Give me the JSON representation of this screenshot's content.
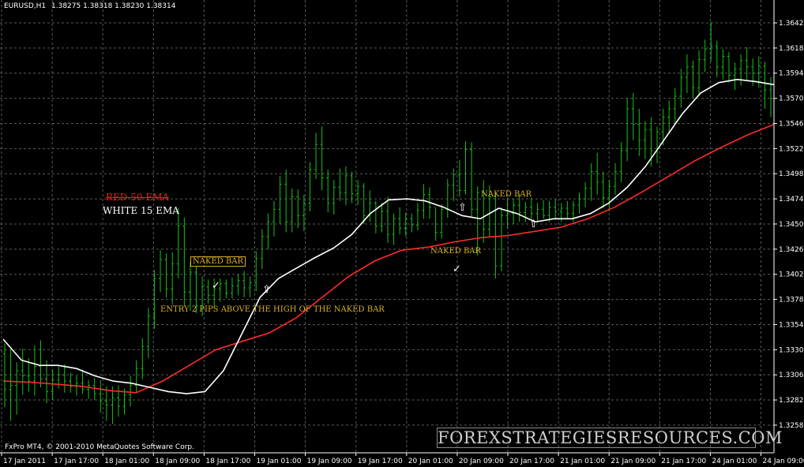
{
  "header": {
    "symbol": "EURUSD,H1",
    "quote": "1.38275 1.38318 1.38230 1.38314"
  },
  "footer": {
    "copyright": "FxPro MT4, © 2001-2010 MetaQuotes Software Corp.",
    "watermark": "FOREXSTRATEGIESRESOURCES.COM"
  },
  "legend": {
    "red_label": "RED 50 EMA",
    "white_label": "WHITE 15 EMA"
  },
  "annotations": {
    "naked_bar_1": "NAKED BAR",
    "naked_bar_2": "NAKED BAR",
    "naked_bar_3": "NAKED BAR",
    "entry_note": "ENTRY 2 PIPS ABOVE THE HIGH OF THE NAKED BAR"
  },
  "markers": {
    "check_icon": "check-icon",
    "arrow_icon": "up-arrow-icon"
  },
  "colors": {
    "background": "#000000",
    "grid": "#5a5a5a",
    "bars": "#16c216",
    "ema15": "#ffffff",
    "ema50": "#ff2a2a",
    "annotation": "#d8b020",
    "axis_text": "#ffffff"
  },
  "chart_data": {
    "type": "ohlc",
    "title": "EURUSD,H1",
    "y_ticks": [
      "1.36420",
      "1.36180",
      "1.35940",
      "1.35700",
      "1.35460",
      "1.35220",
      "1.34980",
      "1.34740",
      "1.34500",
      "1.34260",
      "1.34020",
      "1.33780",
      "1.33540",
      "1.33300",
      "1.33060",
      "1.32820",
      "1.32580"
    ],
    "ylim": [
      1.3248,
      1.3652
    ],
    "x_ticks": [
      "17 Jan 2011",
      "17 Jan 17:00",
      "18 Jan 01:00",
      "18 Jan 09:00",
      "18 Jan 17:00",
      "19 Jan 01:00",
      "19 Jan 09:00",
      "19 Jan 17:00",
      "20 Jan 01:00",
      "20 Jan 09:00",
      "20 Jan 17:00",
      "21 Jan 01:00",
      "21 Jan 09:00",
      "21 Jan 17:00",
      "24 Jan 01:00",
      "24 Jan 09:00"
    ],
    "grid": true,
    "bars": [
      {
        "o": 1.3326,
        "h": 1.3336,
        "l": 1.3275,
        "c": 1.3292
      },
      {
        "o": 1.3292,
        "h": 1.333,
        "l": 1.3262,
        "c": 1.3296
      },
      {
        "o": 1.3296,
        "h": 1.3318,
        "l": 1.3268,
        "c": 1.331
      },
      {
        "o": 1.331,
        "h": 1.3331,
        "l": 1.3287,
        "c": 1.3305
      },
      {
        "o": 1.3305,
        "h": 1.3322,
        "l": 1.329,
        "c": 1.33
      },
      {
        "o": 1.33,
        "h": 1.3334,
        "l": 1.3286,
        "c": 1.3314
      },
      {
        "o": 1.3314,
        "h": 1.3339,
        "l": 1.3294,
        "c": 1.3302
      },
      {
        "o": 1.3302,
        "h": 1.332,
        "l": 1.3279,
        "c": 1.329
      },
      {
        "o": 1.329,
        "h": 1.3311,
        "l": 1.3282,
        "c": 1.3301
      },
      {
        "o": 1.3301,
        "h": 1.3314,
        "l": 1.3293,
        "c": 1.3306
      },
      {
        "o": 1.3306,
        "h": 1.3316,
        "l": 1.3289,
        "c": 1.33
      },
      {
        "o": 1.33,
        "h": 1.3308,
        "l": 1.3289,
        "c": 1.3295
      },
      {
        "o": 1.3295,
        "h": 1.3305,
        "l": 1.3286,
        "c": 1.3298
      },
      {
        "o": 1.3298,
        "h": 1.3311,
        "l": 1.3288,
        "c": 1.3292
      },
      {
        "o": 1.3292,
        "h": 1.3301,
        "l": 1.3283,
        "c": 1.3296
      },
      {
        "o": 1.3296,
        "h": 1.3303,
        "l": 1.3282,
        "c": 1.3288
      },
      {
        "o": 1.3288,
        "h": 1.3301,
        "l": 1.327,
        "c": 1.3281
      },
      {
        "o": 1.3281,
        "h": 1.3295,
        "l": 1.3262,
        "c": 1.3277
      },
      {
        "o": 1.3277,
        "h": 1.3295,
        "l": 1.3259,
        "c": 1.3284
      },
      {
        "o": 1.3284,
        "h": 1.3296,
        "l": 1.3266,
        "c": 1.3276
      },
      {
        "o": 1.3276,
        "h": 1.3293,
        "l": 1.3268,
        "c": 1.3287
      },
      {
        "o": 1.3287,
        "h": 1.3305,
        "l": 1.3276,
        "c": 1.3296
      },
      {
        "o": 1.3296,
        "h": 1.332,
        "l": 1.3289,
        "c": 1.3312
      },
      {
        "o": 1.3312,
        "h": 1.3341,
        "l": 1.3302,
        "c": 1.3333
      },
      {
        "o": 1.3333,
        "h": 1.337,
        "l": 1.3322,
        "c": 1.3362
      },
      {
        "o": 1.3362,
        "h": 1.3406,
        "l": 1.335,
        "c": 1.3398
      },
      {
        "o": 1.3398,
        "h": 1.3425,
        "l": 1.3385,
        "c": 1.3416
      },
      {
        "o": 1.3416,
        "h": 1.3422,
        "l": 1.338,
        "c": 1.3388
      },
      {
        "o": 1.3388,
        "h": 1.3423,
        "l": 1.3373,
        "c": 1.3412
      },
      {
        "o": 1.3412,
        "h": 1.3465,
        "l": 1.3398,
        "c": 1.3448
      },
      {
        "o": 1.3448,
        "h": 1.3456,
        "l": 1.3372,
        "c": 1.3385
      },
      {
        "o": 1.3385,
        "h": 1.3414,
        "l": 1.3367,
        "c": 1.3404
      },
      {
        "o": 1.3404,
        "h": 1.341,
        "l": 1.3365,
        "c": 1.3372
      },
      {
        "o": 1.3372,
        "h": 1.34,
        "l": 1.3362,
        "c": 1.339
      },
      {
        "o": 1.339,
        "h": 1.3397,
        "l": 1.3374,
        "c": 1.3382
      },
      {
        "o": 1.3382,
        "h": 1.3398,
        "l": 1.337,
        "c": 1.3388
      },
      {
        "o": 1.3388,
        "h": 1.3398,
        "l": 1.3376,
        "c": 1.3393
      },
      {
        "o": 1.3393,
        "h": 1.3397,
        "l": 1.3379,
        "c": 1.3384
      },
      {
        "o": 1.3384,
        "h": 1.3399,
        "l": 1.3379,
        "c": 1.3391
      },
      {
        "o": 1.3391,
        "h": 1.3402,
        "l": 1.3382,
        "c": 1.3396
      },
      {
        "o": 1.3396,
        "h": 1.3405,
        "l": 1.338,
        "c": 1.3389
      },
      {
        "o": 1.3389,
        "h": 1.34,
        "l": 1.338,
        "c": 1.3394
      },
      {
        "o": 1.3394,
        "h": 1.3424,
        "l": 1.3386,
        "c": 1.3417
      },
      {
        "o": 1.3417,
        "h": 1.3445,
        "l": 1.3407,
        "c": 1.3438
      },
      {
        "o": 1.3438,
        "h": 1.346,
        "l": 1.3426,
        "c": 1.3452
      },
      {
        "o": 1.3452,
        "h": 1.3472,
        "l": 1.3438,
        "c": 1.3464
      },
      {
        "o": 1.3464,
        "h": 1.3496,
        "l": 1.345,
        "c": 1.3488
      },
      {
        "o": 1.3488,
        "h": 1.3502,
        "l": 1.3442,
        "c": 1.3452
      },
      {
        "o": 1.3452,
        "h": 1.3484,
        "l": 1.3442,
        "c": 1.3476
      },
      {
        "o": 1.3476,
        "h": 1.3483,
        "l": 1.3446,
        "c": 1.3458
      },
      {
        "o": 1.3458,
        "h": 1.3478,
        "l": 1.3443,
        "c": 1.347
      },
      {
        "o": 1.347,
        "h": 1.3509,
        "l": 1.3462,
        "c": 1.3502
      },
      {
        "o": 1.3502,
        "h": 1.3537,
        "l": 1.3493,
        "c": 1.3526
      },
      {
        "o": 1.3526,
        "h": 1.3543,
        "l": 1.3482,
        "c": 1.3494
      },
      {
        "o": 1.3494,
        "h": 1.3502,
        "l": 1.3461,
        "c": 1.347
      },
      {
        "o": 1.347,
        "h": 1.3492,
        "l": 1.3459,
        "c": 1.3485
      },
      {
        "o": 1.3485,
        "h": 1.3503,
        "l": 1.3472,
        "c": 1.348
      },
      {
        "o": 1.348,
        "h": 1.3505,
        "l": 1.3468,
        "c": 1.3496
      },
      {
        "o": 1.3496,
        "h": 1.35,
        "l": 1.347,
        "c": 1.3479
      },
      {
        "o": 1.3479,
        "h": 1.3492,
        "l": 1.3468,
        "c": 1.3486
      },
      {
        "o": 1.3486,
        "h": 1.3489,
        "l": 1.345,
        "c": 1.3458
      },
      {
        "o": 1.3458,
        "h": 1.3482,
        "l": 1.3452,
        "c": 1.347
      },
      {
        "o": 1.347,
        "h": 1.3472,
        "l": 1.3441,
        "c": 1.3448
      },
      {
        "o": 1.3448,
        "h": 1.347,
        "l": 1.3442,
        "c": 1.3462
      },
      {
        "o": 1.3462,
        "h": 1.3476,
        "l": 1.3432,
        "c": 1.344
      },
      {
        "o": 1.344,
        "h": 1.346,
        "l": 1.343,
        "c": 1.3455
      },
      {
        "o": 1.3455,
        "h": 1.3466,
        "l": 1.344,
        "c": 1.3446
      },
      {
        "o": 1.3446,
        "h": 1.3461,
        "l": 1.3438,
        "c": 1.3455
      },
      {
        "o": 1.3455,
        "h": 1.346,
        "l": 1.3442,
        "c": 1.3449
      },
      {
        "o": 1.3449,
        "h": 1.347,
        "l": 1.3444,
        "c": 1.3463
      },
      {
        "o": 1.3463,
        "h": 1.3488,
        "l": 1.3455,
        "c": 1.3478
      },
      {
        "o": 1.3478,
        "h": 1.3485,
        "l": 1.3455,
        "c": 1.3466
      },
      {
        "o": 1.3466,
        "h": 1.3465,
        "l": 1.3434,
        "c": 1.3442
      },
      {
        "o": 1.3442,
        "h": 1.3469,
        "l": 1.3436,
        "c": 1.3464
      },
      {
        "o": 1.3464,
        "h": 1.3493,
        "l": 1.3456,
        "c": 1.3487
      },
      {
        "o": 1.3487,
        "h": 1.3503,
        "l": 1.3472,
        "c": 1.3497
      },
      {
        "o": 1.3497,
        "h": 1.3511,
        "l": 1.3476,
        "c": 1.3482
      },
      {
        "o": 1.3482,
        "h": 1.3529,
        "l": 1.3478,
        "c": 1.3521
      },
      {
        "o": 1.3521,
        "h": 1.3528,
        "l": 1.3456,
        "c": 1.3464
      },
      {
        "o": 1.3464,
        "h": 1.3486,
        "l": 1.342,
        "c": 1.348
      },
      {
        "o": 1.348,
        "h": 1.3492,
        "l": 1.3432,
        "c": 1.3445
      },
      {
        "o": 1.3445,
        "h": 1.3487,
        "l": 1.3438,
        "c": 1.3476
      },
      {
        "o": 1.3476,
        "h": 1.3481,
        "l": 1.3398,
        "c": 1.341
      },
      {
        "o": 1.341,
        "h": 1.3466,
        "l": 1.3405,
        "c": 1.3458
      },
      {
        "o": 1.3458,
        "h": 1.3475,
        "l": 1.3446,
        "c": 1.346
      },
      {
        "o": 1.346,
        "h": 1.3474,
        "l": 1.345,
        "c": 1.3468
      },
      {
        "o": 1.3468,
        "h": 1.3478,
        "l": 1.3452,
        "c": 1.3461
      },
      {
        "o": 1.3461,
        "h": 1.3471,
        "l": 1.3452,
        "c": 1.3466
      },
      {
        "o": 1.3466,
        "h": 1.3475,
        "l": 1.3455,
        "c": 1.346
      },
      {
        "o": 1.346,
        "h": 1.347,
        "l": 1.3452,
        "c": 1.3464
      },
      {
        "o": 1.3464,
        "h": 1.3473,
        "l": 1.3455,
        "c": 1.3458
      },
      {
        "o": 1.3458,
        "h": 1.3472,
        "l": 1.3452,
        "c": 1.3466
      },
      {
        "o": 1.3466,
        "h": 1.3474,
        "l": 1.3454,
        "c": 1.3462
      },
      {
        "o": 1.3462,
        "h": 1.347,
        "l": 1.3452,
        "c": 1.3465
      },
      {
        "o": 1.3465,
        "h": 1.3472,
        "l": 1.3455,
        "c": 1.346
      },
      {
        "o": 1.346,
        "h": 1.3472,
        "l": 1.3452,
        "c": 1.3468
      },
      {
        "o": 1.3468,
        "h": 1.348,
        "l": 1.346,
        "c": 1.3474
      },
      {
        "o": 1.3474,
        "h": 1.349,
        "l": 1.3466,
        "c": 1.3484
      },
      {
        "o": 1.3484,
        "h": 1.3508,
        "l": 1.3472,
        "c": 1.35
      },
      {
        "o": 1.35,
        "h": 1.3518,
        "l": 1.3478,
        "c": 1.349
      },
      {
        "o": 1.349,
        "h": 1.35,
        "l": 1.3465,
        "c": 1.3475
      },
      {
        "o": 1.3475,
        "h": 1.3492,
        "l": 1.3462,
        "c": 1.3486
      },
      {
        "o": 1.3486,
        "h": 1.3508,
        "l": 1.3478,
        "c": 1.35
      },
      {
        "o": 1.35,
        "h": 1.3528,
        "l": 1.349,
        "c": 1.352
      },
      {
        "o": 1.352,
        "h": 1.357,
        "l": 1.351,
        "c": 1.356
      },
      {
        "o": 1.356,
        "h": 1.3575,
        "l": 1.353,
        "c": 1.3545
      },
      {
        "o": 1.3545,
        "h": 1.356,
        "l": 1.3515,
        "c": 1.353
      },
      {
        "o": 1.353,
        "h": 1.3548,
        "l": 1.3512,
        "c": 1.354
      },
      {
        "o": 1.354,
        "h": 1.3552,
        "l": 1.3505,
        "c": 1.352
      },
      {
        "o": 1.352,
        "h": 1.3543,
        "l": 1.3508,
        "c": 1.3538
      },
      {
        "o": 1.3538,
        "h": 1.356,
        "l": 1.3525,
        "c": 1.3552
      },
      {
        "o": 1.3552,
        "h": 1.3568,
        "l": 1.3538,
        "c": 1.356
      },
      {
        "o": 1.356,
        "h": 1.358,
        "l": 1.3545,
        "c": 1.3572
      },
      {
        "o": 1.3572,
        "h": 1.3598,
        "l": 1.3561,
        "c": 1.359
      },
      {
        "o": 1.359,
        "h": 1.3612,
        "l": 1.3575,
        "c": 1.36
      },
      {
        "o": 1.36,
        "h": 1.3606,
        "l": 1.357,
        "c": 1.358
      },
      {
        "o": 1.358,
        "h": 1.3616,
        "l": 1.3572,
        "c": 1.3607
      },
      {
        "o": 1.3607,
        "h": 1.3626,
        "l": 1.3595,
        "c": 1.3617
      },
      {
        "o": 1.3617,
        "h": 1.3643,
        "l": 1.3605,
        "c": 1.362
      },
      {
        "o": 1.362,
        "h": 1.3625,
        "l": 1.359,
        "c": 1.36
      },
      {
        "o": 1.36,
        "h": 1.3617,
        "l": 1.3588,
        "c": 1.361
      },
      {
        "o": 1.361,
        "h": 1.3614,
        "l": 1.3585,
        "c": 1.3592
      },
      {
        "o": 1.3592,
        "h": 1.3604,
        "l": 1.3578,
        "c": 1.3598
      },
      {
        "o": 1.3598,
        "h": 1.3612,
        "l": 1.3582,
        "c": 1.3606
      },
      {
        "o": 1.3606,
        "h": 1.3619,
        "l": 1.3588,
        "c": 1.36
      },
      {
        "o": 1.36,
        "h": 1.3608,
        "l": 1.3582,
        "c": 1.3594
      },
      {
        "o": 1.3594,
        "h": 1.361,
        "l": 1.358,
        "c": 1.3601
      },
      {
        "o": 1.3601,
        "h": 1.3605,
        "l": 1.356,
        "c": 1.3578
      },
      {
        "o": 1.3578,
        "h": 1.359,
        "l": 1.3552,
        "c": 1.357
      }
    ],
    "ema15": [
      1.334,
      1.332,
      1.3315,
      1.3315,
      1.3312,
      1.3305,
      1.33,
      1.3298,
      1.3294,
      1.329,
      1.3288,
      1.329,
      1.331,
      1.3345,
      1.338,
      1.3398,
      1.3408,
      1.3418,
      1.3427,
      1.344,
      1.346,
      1.3473,
      1.3474,
      1.3472,
      1.3466,
      1.3458,
      1.3455,
      1.3465,
      1.346,
      1.3452,
      1.3455,
      1.3455,
      1.346,
      1.347,
      1.3485,
      1.3505,
      1.353,
      1.3555,
      1.3575,
      1.3585,
      1.3588,
      1.3586,
      1.3583
    ],
    "ema50": [
      1.33,
      1.3299,
      1.3297,
      1.3295,
      1.3291,
      1.3289,
      1.33,
      1.3315,
      1.333,
      1.3338,
      1.3346,
      1.336,
      1.338,
      1.34,
      1.3415,
      1.3425,
      1.3428,
      1.3433,
      1.3437,
      1.3439,
      1.3443,
      1.3447,
      1.3455,
      1.3466,
      1.348,
      1.3495,
      1.351,
      1.3523,
      1.3535,
      1.3545
    ],
    "series": [
      {
        "name": "WHITE 15 EMA"
      },
      {
        "name": "RED 50 EMA"
      }
    ]
  }
}
